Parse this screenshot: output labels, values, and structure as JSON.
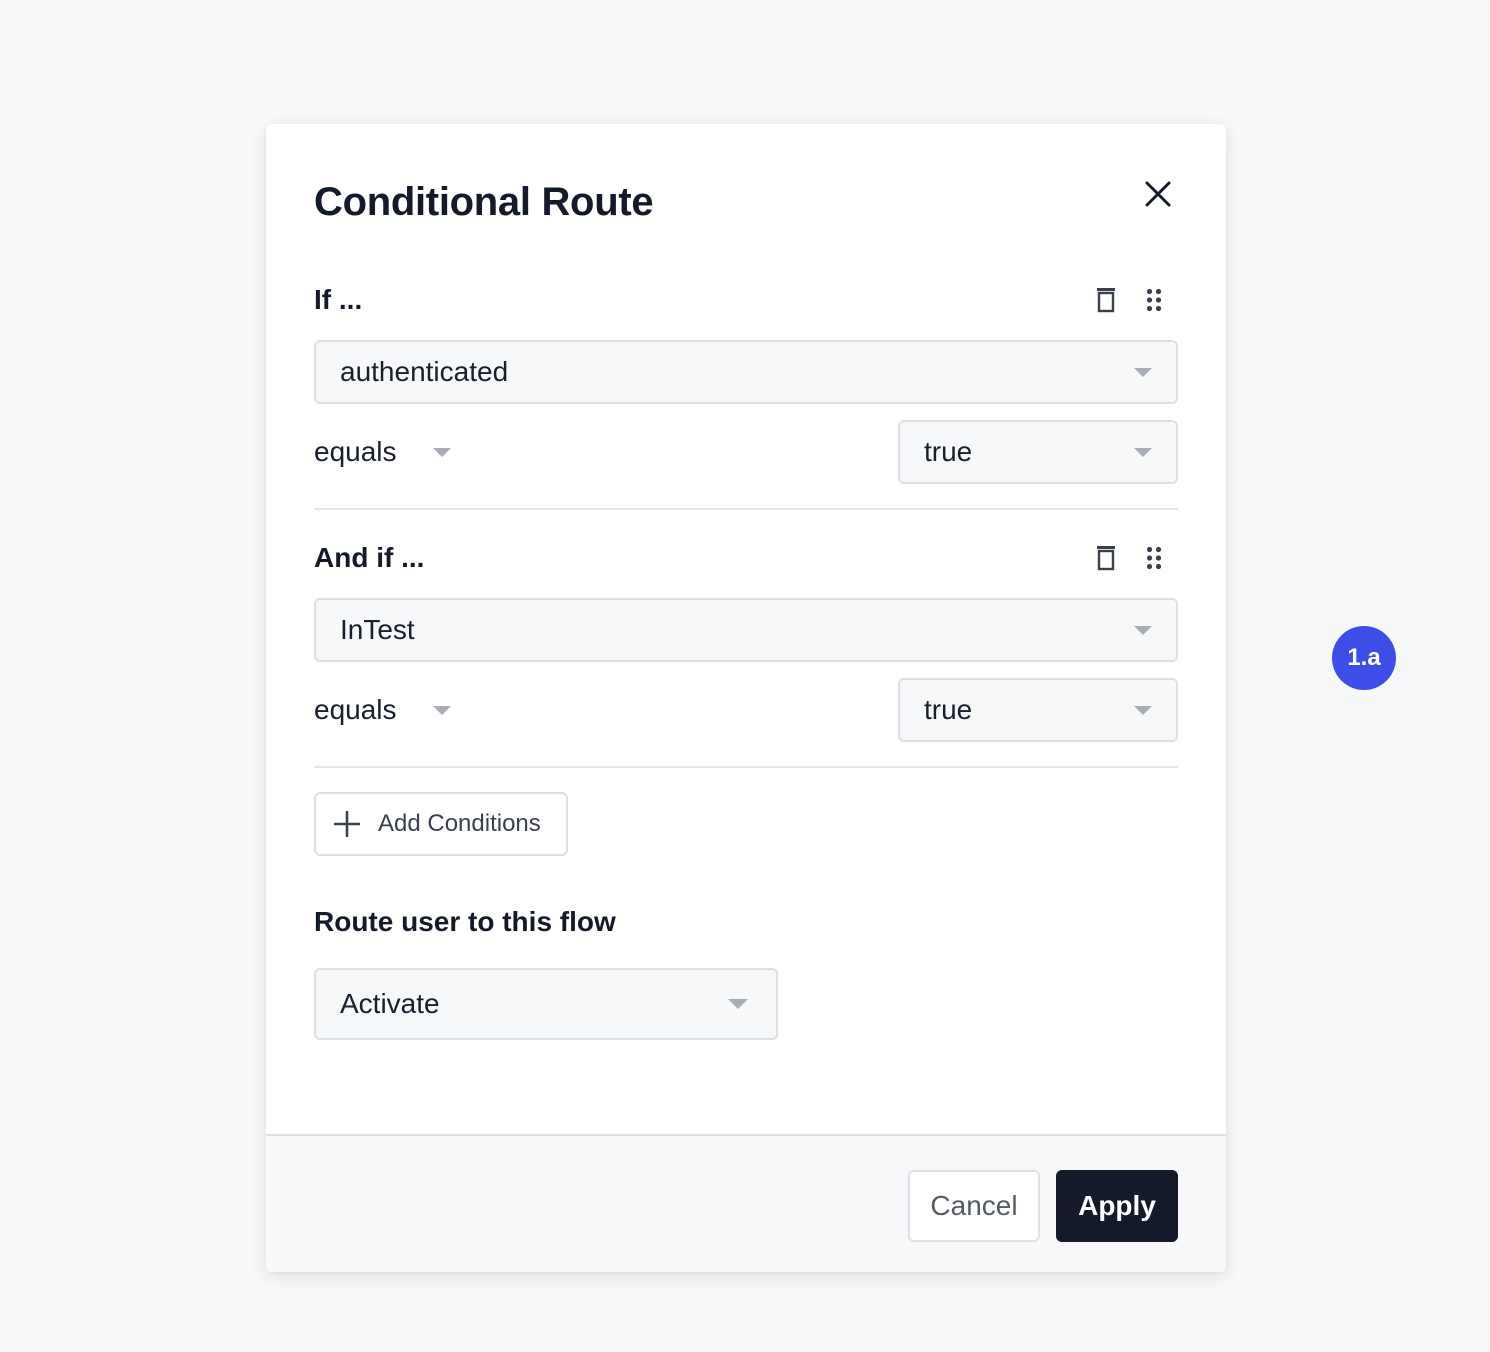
{
  "modal": {
    "title": "Conditional Route",
    "close_icon": "close-icon"
  },
  "conditions": [
    {
      "header": "If ...",
      "attribute": "authenticated",
      "operator": "equals",
      "value": "true"
    },
    {
      "header": "And if ...",
      "attribute": "InTest",
      "operator": "equals",
      "value": "true"
    }
  ],
  "add_conditions": {
    "label": "Add Conditions",
    "icon": "plus-icon"
  },
  "route": {
    "label": "Route user to this flow",
    "selected_flow": "Activate"
  },
  "footer": {
    "cancel_label": "Cancel",
    "apply_label": "Apply"
  },
  "step_badge": {
    "label": "1.a",
    "color": "#3d4de8"
  },
  "colors": {
    "primary_button": "#141a2a",
    "background": "#f7f8f9",
    "border": "#dde0e4"
  }
}
